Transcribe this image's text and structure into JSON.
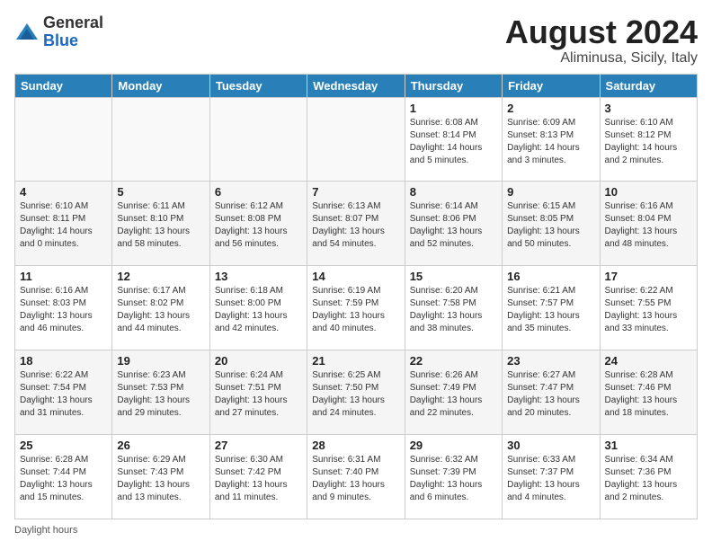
{
  "header": {
    "logo_general": "General",
    "logo_blue": "Blue",
    "month_year": "August 2024",
    "location": "Aliminusa, Sicily, Italy"
  },
  "days_of_week": [
    "Sunday",
    "Monday",
    "Tuesday",
    "Wednesday",
    "Thursday",
    "Friday",
    "Saturday"
  ],
  "weeks": [
    [
      {
        "day": "",
        "info": ""
      },
      {
        "day": "",
        "info": ""
      },
      {
        "day": "",
        "info": ""
      },
      {
        "day": "",
        "info": ""
      },
      {
        "day": "1",
        "info": "Sunrise: 6:08 AM\nSunset: 8:14 PM\nDaylight: 14 hours\nand 5 minutes."
      },
      {
        "day": "2",
        "info": "Sunrise: 6:09 AM\nSunset: 8:13 PM\nDaylight: 14 hours\nand 3 minutes."
      },
      {
        "day": "3",
        "info": "Sunrise: 6:10 AM\nSunset: 8:12 PM\nDaylight: 14 hours\nand 2 minutes."
      }
    ],
    [
      {
        "day": "4",
        "info": "Sunrise: 6:10 AM\nSunset: 8:11 PM\nDaylight: 14 hours\nand 0 minutes."
      },
      {
        "day": "5",
        "info": "Sunrise: 6:11 AM\nSunset: 8:10 PM\nDaylight: 13 hours\nand 58 minutes."
      },
      {
        "day": "6",
        "info": "Sunrise: 6:12 AM\nSunset: 8:08 PM\nDaylight: 13 hours\nand 56 minutes."
      },
      {
        "day": "7",
        "info": "Sunrise: 6:13 AM\nSunset: 8:07 PM\nDaylight: 13 hours\nand 54 minutes."
      },
      {
        "day": "8",
        "info": "Sunrise: 6:14 AM\nSunset: 8:06 PM\nDaylight: 13 hours\nand 52 minutes."
      },
      {
        "day": "9",
        "info": "Sunrise: 6:15 AM\nSunset: 8:05 PM\nDaylight: 13 hours\nand 50 minutes."
      },
      {
        "day": "10",
        "info": "Sunrise: 6:16 AM\nSunset: 8:04 PM\nDaylight: 13 hours\nand 48 minutes."
      }
    ],
    [
      {
        "day": "11",
        "info": "Sunrise: 6:16 AM\nSunset: 8:03 PM\nDaylight: 13 hours\nand 46 minutes."
      },
      {
        "day": "12",
        "info": "Sunrise: 6:17 AM\nSunset: 8:02 PM\nDaylight: 13 hours\nand 44 minutes."
      },
      {
        "day": "13",
        "info": "Sunrise: 6:18 AM\nSunset: 8:00 PM\nDaylight: 13 hours\nand 42 minutes."
      },
      {
        "day": "14",
        "info": "Sunrise: 6:19 AM\nSunset: 7:59 PM\nDaylight: 13 hours\nand 40 minutes."
      },
      {
        "day": "15",
        "info": "Sunrise: 6:20 AM\nSunset: 7:58 PM\nDaylight: 13 hours\nand 38 minutes."
      },
      {
        "day": "16",
        "info": "Sunrise: 6:21 AM\nSunset: 7:57 PM\nDaylight: 13 hours\nand 35 minutes."
      },
      {
        "day": "17",
        "info": "Sunrise: 6:22 AM\nSunset: 7:55 PM\nDaylight: 13 hours\nand 33 minutes."
      }
    ],
    [
      {
        "day": "18",
        "info": "Sunrise: 6:22 AM\nSunset: 7:54 PM\nDaylight: 13 hours\nand 31 minutes."
      },
      {
        "day": "19",
        "info": "Sunrise: 6:23 AM\nSunset: 7:53 PM\nDaylight: 13 hours\nand 29 minutes."
      },
      {
        "day": "20",
        "info": "Sunrise: 6:24 AM\nSunset: 7:51 PM\nDaylight: 13 hours\nand 27 minutes."
      },
      {
        "day": "21",
        "info": "Sunrise: 6:25 AM\nSunset: 7:50 PM\nDaylight: 13 hours\nand 24 minutes."
      },
      {
        "day": "22",
        "info": "Sunrise: 6:26 AM\nSunset: 7:49 PM\nDaylight: 13 hours\nand 22 minutes."
      },
      {
        "day": "23",
        "info": "Sunrise: 6:27 AM\nSunset: 7:47 PM\nDaylight: 13 hours\nand 20 minutes."
      },
      {
        "day": "24",
        "info": "Sunrise: 6:28 AM\nSunset: 7:46 PM\nDaylight: 13 hours\nand 18 minutes."
      }
    ],
    [
      {
        "day": "25",
        "info": "Sunrise: 6:28 AM\nSunset: 7:44 PM\nDaylight: 13 hours\nand 15 minutes."
      },
      {
        "day": "26",
        "info": "Sunrise: 6:29 AM\nSunset: 7:43 PM\nDaylight: 13 hours\nand 13 minutes."
      },
      {
        "day": "27",
        "info": "Sunrise: 6:30 AM\nSunset: 7:42 PM\nDaylight: 13 hours\nand 11 minutes."
      },
      {
        "day": "28",
        "info": "Sunrise: 6:31 AM\nSunset: 7:40 PM\nDaylight: 13 hours\nand 9 minutes."
      },
      {
        "day": "29",
        "info": "Sunrise: 6:32 AM\nSunset: 7:39 PM\nDaylight: 13 hours\nand 6 minutes."
      },
      {
        "day": "30",
        "info": "Sunrise: 6:33 AM\nSunset: 7:37 PM\nDaylight: 13 hours\nand 4 minutes."
      },
      {
        "day": "31",
        "info": "Sunrise: 6:34 AM\nSunset: 7:36 PM\nDaylight: 13 hours\nand 2 minutes."
      }
    ]
  ],
  "footer": {
    "note": "Daylight hours"
  }
}
